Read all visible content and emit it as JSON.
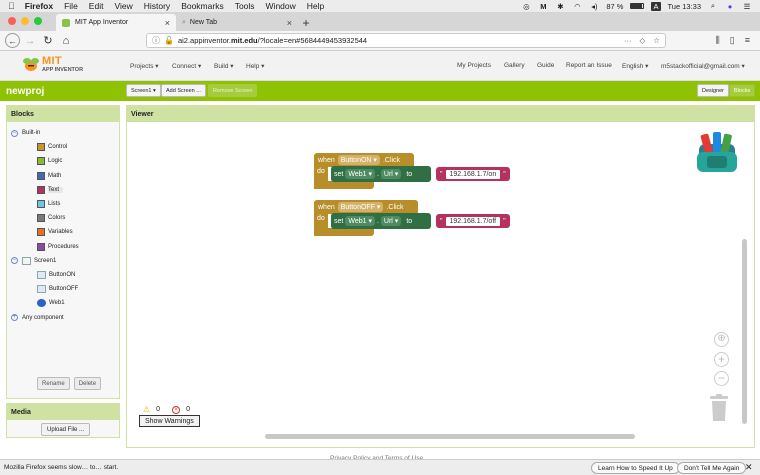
{
  "menubar": {
    "app": "Firefox",
    "items": [
      "File",
      "Edit",
      "View",
      "History",
      "Bookmarks",
      "Tools",
      "Window",
      "Help"
    ],
    "battery": "87 %",
    "keyboard": "A",
    "clock": "Tue 13:33"
  },
  "tabs": [
    {
      "title": "MIT App Inventor",
      "active": true
    },
    {
      "title": "New Tab",
      "active": false
    }
  ],
  "url": {
    "prefix": "ai2.appinventor.",
    "domain": "mit.edu",
    "suffix": "/?locale=en#5684449453932544",
    "more": "···"
  },
  "header": {
    "logo_title": "MIT",
    "logo_sub": "APP INVENTOR",
    "menus": [
      "Projects ▾",
      "Connect ▾",
      "Build ▾",
      "Help ▾"
    ],
    "right_links": [
      "My Projects",
      "Gallery",
      "Guide",
      "Report an Issue",
      "English ▾",
      "m5stackofficial@gmail.com ▾"
    ]
  },
  "project": {
    "name": "newproj",
    "screen_select": "Screen1 ▾",
    "add_screen": "Add Screen ...",
    "remove_screen": "Remove Screen",
    "designer": "Designer",
    "blocks": "Blocks"
  },
  "blocks_panel": {
    "title": "Blocks",
    "builtin_label": "Built-in",
    "builtin_items": [
      {
        "label": "Control",
        "color": "#c8962a"
      },
      {
        "label": "Logic",
        "color": "#8cb63c"
      },
      {
        "label": "Math",
        "color": "#3f6ab4"
      },
      {
        "label": "Text",
        "color": "#b5315f"
      },
      {
        "label": "Lists",
        "color": "#6fc4ea"
      },
      {
        "label": "Colors",
        "color": "#7a7a7a"
      },
      {
        "label": "Variables",
        "color": "#e8711c"
      },
      {
        "label": "Procedures",
        "color": "#8a4c9c"
      }
    ],
    "screen_label": "Screen1",
    "components": [
      "ButtonON",
      "ButtonOFF",
      "Web1"
    ],
    "any_component": "Any component",
    "rename": "Rename",
    "delete": "Delete"
  },
  "media_panel": {
    "title": "Media",
    "upload": "Upload File ..."
  },
  "viewer": {
    "title": "Viewer",
    "events": [
      {
        "when": "when",
        "component": "ButtonON ▾",
        "event": ".Click",
        "do": "do",
        "set": "set",
        "target": "Web1 ▾",
        "dot": ".",
        "prop": "Url ▾",
        "to": "to",
        "quote_open": "\"",
        "value": "192.168.1.7/on",
        "quote_close": "\""
      },
      {
        "when": "when",
        "component": "ButtonOFF ▾",
        "event": ".Click",
        "do": "do",
        "set": "set",
        "target": "Web1 ▾",
        "dot": ".",
        "prop": "Url ▾",
        "to": "to",
        "quote_open": "\"",
        "value": "192.168.1.7/off",
        "quote_close": "\""
      }
    ],
    "warnings_count": "0",
    "errors_count": "0",
    "show_warnings": "Show Warnings"
  },
  "footer": "Privacy Policy and Terms of Use",
  "notification": {
    "message": "Mozilla Firefox seems slow… to… start.",
    "speed_button": "Learn How to Speed It Up",
    "dont_tell": "Don't Tell Me Again",
    "close": "✕"
  }
}
